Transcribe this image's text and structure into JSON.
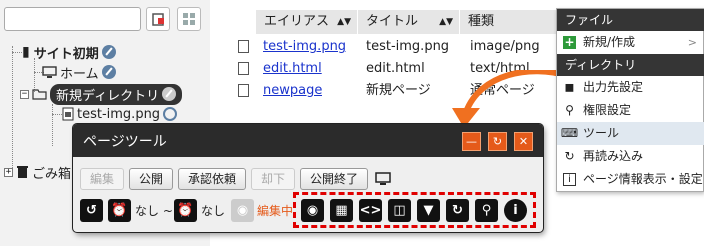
{
  "search": {
    "placeholder": ""
  },
  "tree": {
    "site": "サイト初期",
    "home": "ホーム",
    "new_dir": "新規ディレクトリ",
    "file1": "test-img.png",
    "trash": "ごみ箱"
  },
  "table": {
    "headers": [
      "エイリアス",
      "タイトル",
      "種類"
    ],
    "rows": [
      {
        "alias": "test-img.png",
        "title": "test-img.png",
        "type": "image/png"
      },
      {
        "alias": "edit.html",
        "title": "edit.html",
        "type": "text/html"
      },
      {
        "alias": "newpage",
        "title": "新規ページ",
        "type": "通常ページ"
      }
    ]
  },
  "menu": {
    "file_heading": "ファイル",
    "new_create": "新規/作成",
    "dir_heading": "ディレクトリ",
    "output": "出力先設定",
    "permissions": "権限設定",
    "tools": "ツール",
    "reload": "再読み込み",
    "page_info": "ページ情報表示・設定"
  },
  "page_tool": {
    "title": "ページツール",
    "buttons": [
      "編集",
      "公開",
      "承認依頼",
      "却下",
      "公開終了"
    ],
    "from_none": "なし ~",
    "to_none": "なし",
    "status": "編集中"
  },
  "colors": {
    "accent": "#e55a1a",
    "highlight": "#e00000",
    "link": "#1a33cc"
  }
}
